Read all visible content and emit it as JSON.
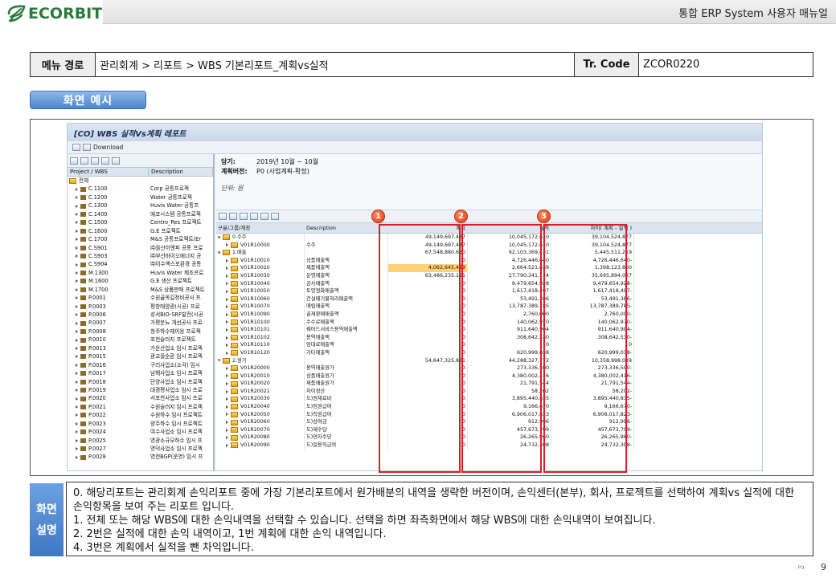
{
  "header": {
    "logo_text": "ECORBIT",
    "title": "통합 ERP System 사용자 매뉴얼"
  },
  "menu": {
    "label": "메뉴 경로",
    "path": "관리회계 > 리포트 > WBS 기본리포트_계획vs실적",
    "tr_label": "Tr. Code",
    "tr_code": "ZCOR0220"
  },
  "section_tag": "화면 예시",
  "sap": {
    "title": "[CO] WBS 실적Vs계획 레포트",
    "download": "Download",
    "left_headers": [
      "Project / WBS",
      "Description"
    ],
    "tree_root": "전체",
    "tree": [
      [
        "C.1100",
        "Corp 공통프로젝"
      ],
      [
        "C.1200",
        "Water 공통프로젝"
      ],
      [
        "C.1300",
        "Huvis Water 공통프"
      ],
      [
        "C.1400",
        "에코시스템 공통프로젝"
      ],
      [
        "C.1500",
        "Centro_Res 프로젝트"
      ],
      [
        "C.1600",
        "G.E 프로젝트"
      ],
      [
        "C.1700",
        "M&S 공통프로젝트(Er"
      ],
      [
        "C.S901",
        "㈜올산이엔피 공통 프로"
      ],
      [
        "C.S903",
        "㈜부산바이오에너지 공"
      ],
      [
        "C.S904",
        "㈜이수엑스포환경 공통"
      ],
      [
        "M.1300",
        "Huvis Water 제조프로"
      ],
      [
        "M.1600",
        "G.E 생산 프로젝트"
      ],
      [
        "M.1700",
        "M&S 상품판매 프로젝트"
      ],
      [
        "P.0001",
        "수원골목길정비공사 프"
      ],
      [
        "P.0003",
        "평창태양광(시공) 프로"
      ],
      [
        "P.0006",
        "성서BIO-SRF발전(시공"
      ],
      [
        "P.0007",
        "가평분뇨 개선공사 프로"
      ],
      [
        "P.0008",
        "청주하수재이용 프로젝"
      ],
      [
        "P.0010",
        "포천슬러지 프로젝트"
      ],
      [
        "P.0013",
        "가운산업소 임시 프로젝"
      ],
      [
        "P.0015",
        "광교플순환 임시 프로젝"
      ],
      [
        "P.0016",
        "구리사업소(소각) 임시"
      ],
      [
        "P.0017",
        "남해사업소 임시 프로젝"
      ],
      [
        "P.0018",
        "단양사업소 임시 프로젝"
      ],
      [
        "P.0019",
        "대경평사업소 임시 프로"
      ],
      [
        "P.0020",
        "서포천사업소 임시 프로"
      ],
      [
        "P.0021",
        "수원슬러지 임시 프로젝"
      ],
      [
        "P.0022",
        "수원하수 임시 프로젝트"
      ],
      [
        "P.0023",
        "양주하수 임시 프로젝트"
      ],
      [
        "P.0024",
        "여수사업소 임시 프로젝"
      ],
      [
        "P.0025",
        "영광소규모하수 임시 프"
      ],
      [
        "P.0027",
        "영덕사업소 임시 프로젝"
      ],
      [
        "P.0028",
        "영천BGP(운영) 임시 프"
      ]
    ],
    "info": {
      "period_label": "당기:",
      "period_value": "2019년 10월 ~ 10월",
      "plan_label": "계획버전:",
      "plan_value": "P0 (사업계획-확정)",
      "unit": "단위: 원"
    },
    "grid_headers": [
      "구분/그룹/계정",
      "Description",
      "계획",
      "실적",
      "차이( 계획 - 실적 )"
    ],
    "grid_rows": [
      {
        "lvl": 0,
        "acct": "0.수주",
        "desc": "",
        "plan": "49,149,697,487",
        "actual": "10,045,172,610",
        "diff": "39,104,524,877"
      },
      {
        "lvl": 1,
        "acct": "V01R10000",
        "desc": "수주",
        "plan": "49,149,697,487",
        "actual": "10,045,172,610",
        "diff": "39,104,524,877"
      },
      {
        "lvl": 0,
        "acct": "1.매출",
        "desc": "",
        "plan": "67,548,880,650",
        "actual": "62,103,369,431",
        "diff": "5,445,511,219"
      },
      {
        "lvl": 1,
        "acct": "V01R10010",
        "desc": "상품매출액",
        "plan": "0",
        "actual": "4,726,446,640",
        "diff": "4,726,446,640-"
      },
      {
        "lvl": 1,
        "acct": "V01R10020",
        "desc": "제품매출액",
        "plan": "4,062,645,499",
        "actual": "2,664,521,639",
        "diff": "1,398,123,860",
        "hl": true
      },
      {
        "lvl": 1,
        "acct": "V01R10030",
        "desc": "운영매출액",
        "plan": "63,486,235,151",
        "actual": "27,790,341,114",
        "diff": "35,695,894,037"
      },
      {
        "lvl": 1,
        "acct": "V01R10040",
        "desc": "공사매출액",
        "plan": "0",
        "actual": "9,479,654,928",
        "diff": "9,479,654,928-"
      },
      {
        "lvl": 1,
        "acct": "V01R10050",
        "desc": "토양정화매출액",
        "plan": "0",
        "actual": "1,617,418,497",
        "diff": "1,617,418,497-"
      },
      {
        "lvl": 1,
        "acct": "V01R10060",
        "desc": "건설폐기물처리매출액",
        "plan": "0",
        "actual": "53,491,386",
        "diff": "53,491,386-"
      },
      {
        "lvl": 1,
        "acct": "V01R10070",
        "desc": "매립매출액",
        "plan": "0",
        "actual": "13,787,389,785",
        "diff": "13,787,389,785-"
      },
      {
        "lvl": 1,
        "acct": "V01R10090",
        "desc": "골재판매매출액",
        "plan": "0",
        "actual": "2,760,000",
        "diff": "2,760,000-"
      },
      {
        "lvl": 1,
        "acct": "V01R10100",
        "desc": "수수료매출액",
        "plan": "0",
        "actual": "140,062,970",
        "diff": "140,062,970-"
      },
      {
        "lvl": 1,
        "acct": "V01R10101",
        "desc": "쉐어드서비스용역매출액",
        "plan": "0",
        "actual": "911,640,904",
        "diff": "911,640,904-"
      },
      {
        "lvl": 1,
        "acct": "V01R10102",
        "desc": "용역매출액",
        "plan": "0",
        "actual": "308,642,530",
        "diff": "308,642,530-"
      },
      {
        "lvl": 1,
        "acct": "V01R10110",
        "desc": "임대료매출액",
        "plan": "0",
        "actual": "0",
        "diff": "0"
      },
      {
        "lvl": 1,
        "acct": "V01R10120",
        "desc": "기타매출액",
        "plan": "0",
        "actual": "620,999,038",
        "diff": "620,999,038-"
      },
      {
        "lvl": 0,
        "acct": "2.원가",
        "desc": "",
        "plan": "54,647,325,861",
        "actual": "44,288,327,772",
        "diff": "10,358,998,089"
      },
      {
        "lvl": 1,
        "acct": "V01R20000",
        "desc": "용역매출원가",
        "plan": "0",
        "actual": "273,336,500",
        "diff": "273,336,500-"
      },
      {
        "lvl": 1,
        "acct": "V01R20010",
        "desc": "상품매출원가",
        "plan": "0",
        "actual": "4,380,002,416",
        "diff": "4,380,002,416-"
      },
      {
        "lvl": 1,
        "acct": "V01R20020",
        "desc": "제품매출원가",
        "plan": "0",
        "actual": "21,791,544",
        "diff": "21,791,544-"
      },
      {
        "lvl": 1,
        "acct": "V01R20021",
        "desc": "차이정산",
        "plan": "0",
        "actual": "58,202",
        "diff": "58,202-"
      },
      {
        "lvl": 1,
        "acct": "V01R20030",
        "desc": "도)원재료비",
        "plan": "0",
        "actual": "3,895,440,835",
        "diff": "3,895,440,835-"
      },
      {
        "lvl": 1,
        "acct": "V01R20040",
        "desc": "도)임원급여",
        "plan": "0",
        "actual": "9,166,670",
        "diff": "9,166,670-"
      },
      {
        "lvl": 1,
        "acct": "V01R20050",
        "desc": "도)직원급여",
        "plan": "0",
        "actual": "6,906,017,823",
        "diff": "6,906,017,823-"
      },
      {
        "lvl": 1,
        "acct": "V01R20060",
        "desc": "도)상여금",
        "plan": "0",
        "actual": "912,996",
        "diff": "912,996-"
      },
      {
        "lvl": 1,
        "acct": "V01R20070",
        "desc": "도)제수당",
        "plan": "0",
        "actual": "457,673,709",
        "diff": "457,673,709-"
      },
      {
        "lvl": 1,
        "acct": "V01R20080",
        "desc": "도)연차수당",
        "plan": "0",
        "actual": "26,265,960",
        "diff": "26,265,960-"
      },
      {
        "lvl": 1,
        "acct": "V01R20090",
        "desc": "도)일용직급여",
        "plan": "0",
        "actual": "24,732,308",
        "diff": "24,732,308-"
      }
    ],
    "badges": [
      "1",
      "2",
      "3"
    ]
  },
  "desc": {
    "label_line1": "화면",
    "label_line2": "설명",
    "lines": [
      "0. 해당리포트는 관리회계 손익리포트 중에 가장 기본리포트에서 원가배분의 내역을 생략한 버전이며, 손익센터(본부), 회사, 프로젝트를 선택하여 계획vs 실적에 대한 손익항목을 보여 주는 리포트 입니다.",
      "1. 전체 또는 해당 WBS에 대한 손익내역을 선택할 수 있습니다. 선택을 하면 좌측화면에서 해당 WBS에 대한 손익내역이 보여집니다.",
      "2. 2번은 실적에 대한 손익 내역이고, 1번 계획에 대한 손익 내역입니다.",
      "4. 3번은 계획에서 실적을 뺀 차익입니다."
    ]
  },
  "footer": {
    "small": "- P9-",
    "page": "9"
  },
  "colors": {
    "logo_green": "#2a7a3b",
    "accent_blue": "#4a86cf",
    "highlight_red": "#d9202a",
    "badge_orange": "#e03a12",
    "cell_highlight": "#ffd27a"
  }
}
